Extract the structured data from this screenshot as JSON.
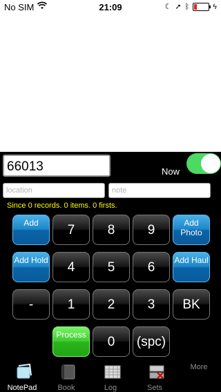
{
  "status": {
    "carrier": "No SIM",
    "time": "21:09"
  },
  "entry": {
    "value": "66013"
  },
  "now_label": "Now",
  "now_toggle": "on",
  "location": {
    "placeholder": "location"
  },
  "note": {
    "placeholder": "note"
  },
  "stats_text": "Since 0 records. 0 items. 0 firsts.",
  "keys": {
    "add": "Add",
    "add_photo": "Add Photo",
    "add_hold": "Add Hold",
    "add_haul": "Add Haul",
    "k7": "7",
    "k8": "8",
    "k9": "9",
    "k4": "4",
    "k5": "5",
    "k6": "6",
    "dash": "-",
    "k1": "1",
    "k2": "2",
    "k3": "3",
    "bk": "BK",
    "process": "Process",
    "k0": "0",
    "spc": "(spc)"
  },
  "tabs": {
    "notepad": "NotePad",
    "book": "Book",
    "log": "Log",
    "sets": "Sets",
    "more": "More"
  },
  "colors": {
    "accent_blue": "#1d86c8",
    "green": "#3fcc2d",
    "stats_yellow": "#ffff00",
    "toggle_green": "#4cd964"
  }
}
